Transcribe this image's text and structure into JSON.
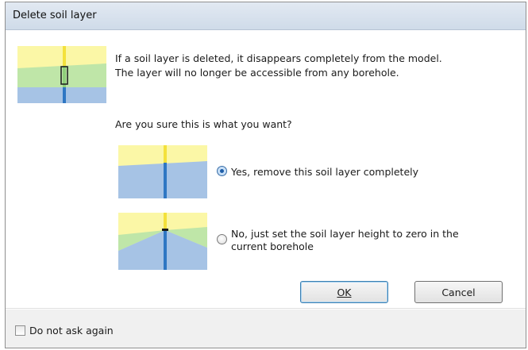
{
  "dialog": {
    "title": "Delete soil layer",
    "message_line1": "If a soil layer is deleted, it disappears completely from the model.",
    "message_line2": "The layer will no longer be accessible from any borehole.",
    "question": "Are you sure this is what you want?",
    "options": [
      {
        "label_line1": "Yes, remove this soil layer completely",
        "label_line2": "",
        "selected": true
      },
      {
        "label_line1": "No, just set the soil layer height to zero in the",
        "label_line2": "current borehole",
        "selected": false
      }
    ],
    "ok_label": "OK",
    "cancel_label": "Cancel",
    "do_not_ask_label": "Do not ask again",
    "do_not_ask_checked": false
  },
  "colors": {
    "soil_yellow": "#fbf7a6",
    "soil_green": "#bfe6a8",
    "soil_blue": "#a6c3e5",
    "borehole_blue": "#2f77c3",
    "borehole_yellow": "#f3e13c"
  }
}
